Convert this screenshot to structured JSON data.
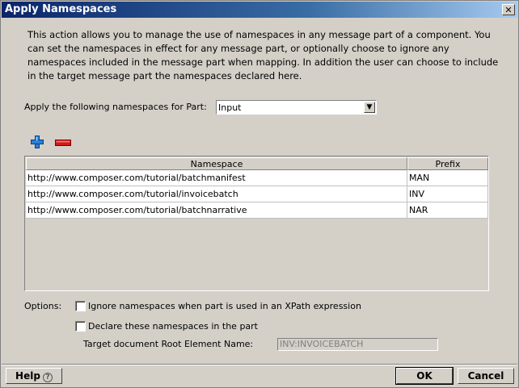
{
  "window": {
    "title": "Apply Namespaces"
  },
  "description": "This action allows you to manage the use of namespaces in any message part of a component. You can set the namespaces in effect for any message part, or optionally choose to ignore any namespaces included in the message part when mapping. In addition the user can choose to include in the target message part the namespaces declared here.",
  "part": {
    "label": "Apply the following namespaces for Part:",
    "selected": "Input"
  },
  "table": {
    "columns": [
      "Namespace",
      "Prefix"
    ],
    "rows": [
      {
        "namespace": "http://www.composer.com/tutorial/batchmanifest",
        "prefix": "MAN"
      },
      {
        "namespace": "http://www.composer.com/tutorial/invoicebatch",
        "prefix": "INV"
      },
      {
        "namespace": "http://www.composer.com/tutorial/batchnarrative",
        "prefix": "NAR"
      }
    ]
  },
  "options": {
    "label": "Options:",
    "ignore_label": "Ignore namespaces when part is used in an XPath expression",
    "ignore_checked": false,
    "declare_label": "Declare these namespaces in the part",
    "declare_checked": false,
    "target_label": "Target document Root Element Name:",
    "target_value": "INV:INVOICEBATCH"
  },
  "buttons": {
    "help": "Help",
    "ok": "OK",
    "cancel": "Cancel"
  },
  "icons": {
    "add": "add-icon",
    "remove": "remove-icon",
    "close": "close-icon",
    "help": "help-icon"
  }
}
